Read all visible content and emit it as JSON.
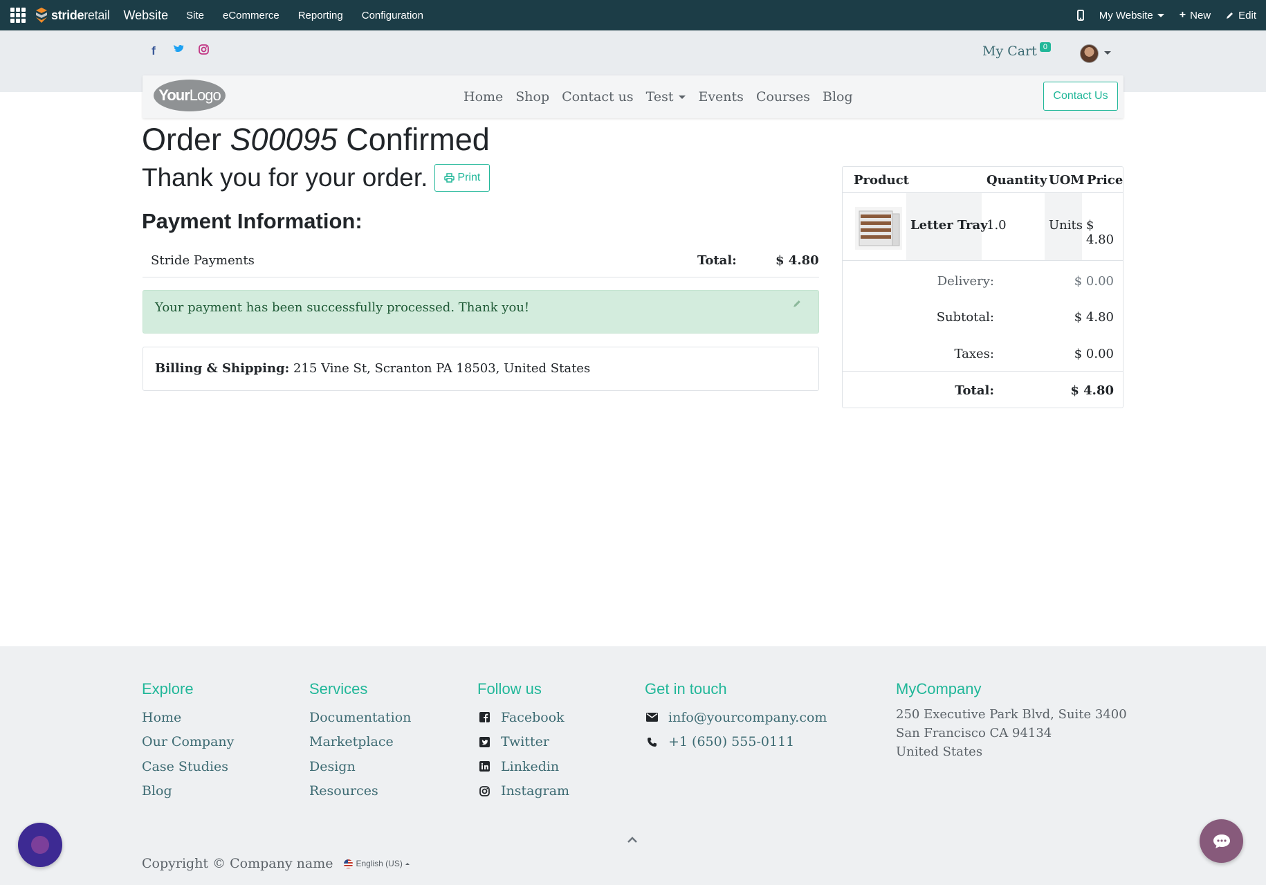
{
  "admin_bar": {
    "brand_bold": "stride",
    "brand_thin": "retail",
    "app_name": "Website",
    "menu": [
      "Site",
      "eCommerce",
      "Reporting",
      "Configuration"
    ],
    "website_selector": "My Website",
    "new_label": "New",
    "edit_label": "Edit"
  },
  "header": {
    "social_icons": [
      "facebook-icon",
      "twitter-icon",
      "instagram-icon"
    ],
    "cart_label": "My Cart",
    "cart_count": "0"
  },
  "navbar": {
    "logo_bold": "Your",
    "logo_thin": "Logo",
    "links": [
      "Home",
      "Shop",
      "Contact us"
    ],
    "dropdown_label": "Test",
    "links_after": [
      "Events",
      "Courses",
      "Blog"
    ],
    "cta_label": "Contact Us"
  },
  "order": {
    "title_prefix": "Order",
    "order_number": "S00095",
    "title_suffix": "Confirmed",
    "thanks": "Thank you for your order.",
    "print_label": "Print",
    "payment_heading": "Payment Information:",
    "payment_method": "Stride Payments",
    "total_label": "Total:",
    "total_value": "$ 4.80",
    "success_message": "Your payment has been successfully processed. Thank you!",
    "address_label": "Billing & Shipping:",
    "address_value": "215 Vine St, Scranton PA 18503, United States"
  },
  "summary": {
    "headers": {
      "product": "Product",
      "quantity": "Quantity",
      "uom": "UOM",
      "price": "Price"
    },
    "item": {
      "name": "Letter Tray",
      "quantity": "1.0",
      "uom": "Units",
      "price": "$ 4.80"
    },
    "delivery_label": "Delivery:",
    "delivery_value": "$ 0.00",
    "subtotal_label": "Subtotal:",
    "subtotal_value": "$ 4.80",
    "taxes_label": "Taxes:",
    "taxes_value": "$ 0.00",
    "total_label": "Total:",
    "total_value": "$ 4.80"
  },
  "footer": {
    "explore": {
      "heading": "Explore",
      "links": [
        "Home",
        "Our Company",
        "Case Studies",
        "Blog"
      ]
    },
    "services": {
      "heading": "Services",
      "links": [
        "Documentation",
        "Marketplace",
        "Design",
        "Resources"
      ]
    },
    "follow": {
      "heading": "Follow us",
      "links": [
        "Facebook",
        "Twitter",
        "Linkedin",
        "Instagram"
      ]
    },
    "contact": {
      "heading": "Get in touch",
      "email": "info@yourcompany.com",
      "phone": "+1 (650) 555-0111"
    },
    "company": {
      "heading": "MyCompany",
      "line1": "250 Executive Park Blvd, Suite 3400",
      "line2": "San Francisco CA 94134",
      "line3": "United States"
    },
    "copyright": "Copyright © Company name",
    "language": "English (US)"
  },
  "colors": {
    "admin_bar": "#1c3d47",
    "accent": "#21b799",
    "link": "#3d6b73",
    "success_bg": "#d3ecdd",
    "chat_button": "#875a7b"
  }
}
